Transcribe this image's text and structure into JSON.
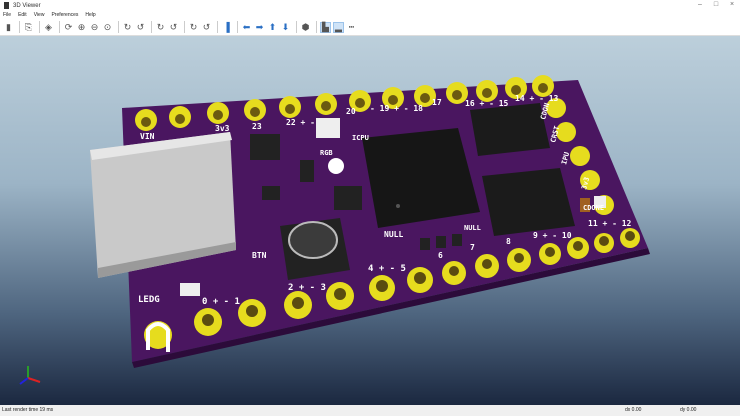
{
  "window": {
    "title": "3D Viewer",
    "controls": [
      "minimize",
      "maximize",
      "close"
    ]
  },
  "menu": [
    "File",
    "Edit",
    "View",
    "Preferences",
    "Help"
  ],
  "toolbar": [
    {
      "icon": "export-image-icon"
    },
    {
      "icon": "copy-3d-image-icon"
    },
    {
      "icon": "render-options-icon"
    },
    {
      "icon": "reload-icon"
    },
    {
      "icon": "zoom-in-icon"
    },
    {
      "icon": "zoom-out-icon"
    },
    {
      "icon": "zoom-fit-icon"
    },
    {
      "icon": "rotate-x-cw-icon"
    },
    {
      "icon": "rotate-x-ccw-icon"
    },
    {
      "icon": "rotate-y-cw-icon"
    },
    {
      "icon": "rotate-y-ccw-icon"
    },
    {
      "icon": "rotate-z-cw-icon"
    },
    {
      "icon": "rotate-z-ccw-icon"
    },
    {
      "icon": "flip-board-icon"
    },
    {
      "icon": "pan-left-icon"
    },
    {
      "icon": "pan-right-icon"
    },
    {
      "icon": "pan-up-icon"
    },
    {
      "icon": "pan-down-icon"
    },
    {
      "icon": "ortho-view-icon"
    },
    {
      "icon": "show-tht-icon",
      "selected": true
    },
    {
      "icon": "show-smd-icon",
      "selected": true
    },
    {
      "icon": "show-virtual-icon"
    }
  ],
  "board": {
    "colors": {
      "soldermask": "#4a1660",
      "pads": "#e6dc1e",
      "silkscreen": "#ffffff",
      "usb": "#c8c8c8",
      "ic": "#111111"
    },
    "silkscreen": {
      "vin": "VIN",
      "v3_top": "3v3",
      "p23": "23",
      "p22": "22 + -",
      "p21": "21",
      "p20": "20",
      "p19": "- 19 + - 18",
      "p17": "17",
      "p16": "16 + - 15",
      "p14": "14 + - 13",
      "cdon": "CDON",
      "crst": "CRST",
      "ipu": "IPU",
      "p3v3r": "3v3",
      "cdone": "CDONE",
      "p11": "11 + - 12",
      "p9": "9 + - 10",
      "p8": "8",
      "p7": "7",
      "p6": "6",
      "p4": "4 + - 5",
      "p2": "2 + - 3",
      "p0": "0 + - 1",
      "ledg": "LEDG",
      "btn": "BTN",
      "null1": "NULL",
      "null2": "NULL",
      "rgb": "RGB",
      "icpu": "ICPU"
    }
  },
  "status": {
    "render_time": "Last render time 19 ms",
    "dx": "dx 0.00",
    "dy": "dy 0.00"
  }
}
